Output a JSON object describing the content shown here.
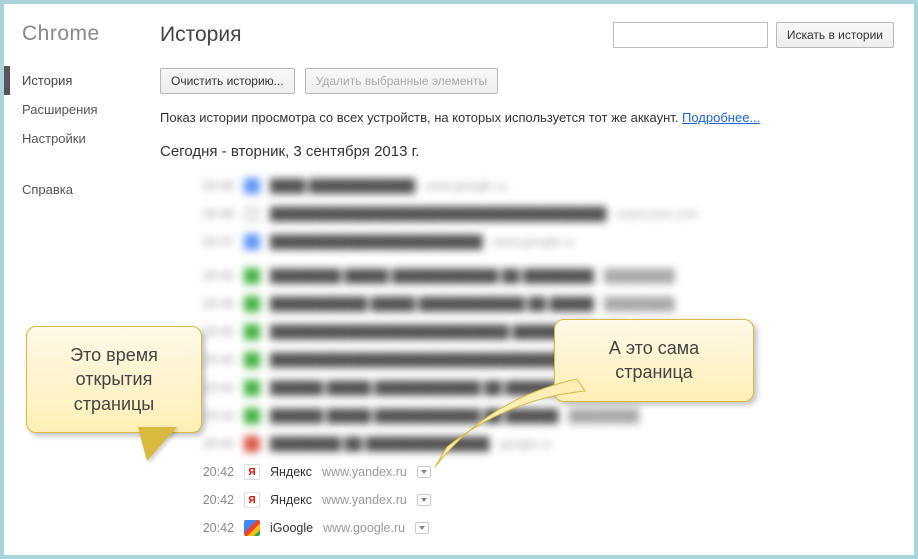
{
  "brand": "Chrome",
  "sidebar": {
    "items": [
      {
        "label": "История",
        "active": true
      },
      {
        "label": "Расширения",
        "active": false
      },
      {
        "label": "Настройки",
        "active": false
      },
      {
        "label": "Справка",
        "active": false
      }
    ]
  },
  "header": {
    "title": "История",
    "search_placeholder": "",
    "search_button": "Искать в истории"
  },
  "toolbar": {
    "clear_label": "Очистить историю...",
    "delete_label": "Удалить выбранные элементы"
  },
  "info": {
    "text": "Показ истории просмотра со всех устройств, на которых используется тот же аккаунт. ",
    "link_label": "Подробнее..."
  },
  "date_header": "Сегодня - вторник, 3 сентября 2013 г.",
  "blurred_rows": [
    {
      "icon": "blue"
    },
    {
      "icon": "page"
    },
    {
      "icon": "blue"
    },
    {
      "icon": "green"
    },
    {
      "icon": "green"
    },
    {
      "icon": "green"
    },
    {
      "icon": "green"
    },
    {
      "icon": "green"
    },
    {
      "icon": "green"
    },
    {
      "icon": "red"
    }
  ],
  "visible_rows": [
    {
      "time": "20:42",
      "icon": "ya",
      "title": "Яндекс",
      "domain": "www.yandex.ru"
    },
    {
      "time": "20:42",
      "icon": "ya",
      "title": "Яндекс",
      "domain": "www.yandex.ru"
    },
    {
      "time": "20:42",
      "icon": "goog",
      "title": "iGoogle",
      "domain": "www.google.ru"
    }
  ],
  "callouts": {
    "left": "Это время открытия страницы",
    "right": "А это сама страница"
  }
}
